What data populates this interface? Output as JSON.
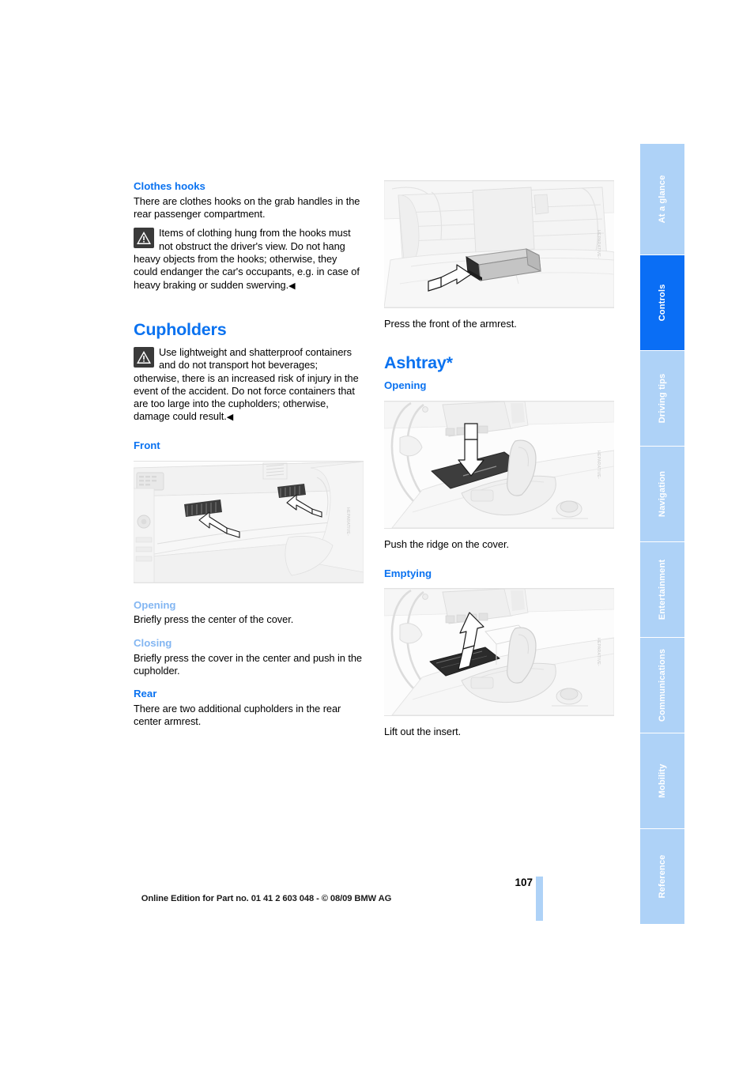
{
  "page": {
    "number": "107",
    "footer_note": "Online Edition for Part no. 01 41 2 603 048 - © 08/09 BMW AG"
  },
  "left_column": {
    "clothes_hooks": {
      "heading": "Clothes hooks",
      "intro": "There are clothes hooks on the grab handles in the rear passenger compartment.",
      "warning": "Items of clothing hung from the hooks must not obstruct the driver's view. Do not hang heavy objects from the hooks; otherwise, they could endanger the car's occupants, e.g. in case of heavy braking or sudden swerving.",
      "warning_end": "◀"
    },
    "cupholders": {
      "heading": "Cupholders",
      "warning": "Use lightweight and shatterproof containers and do not transport hot beverages; otherwise, there is an increased risk of injury in the event of the accident. Do not force containers that are too large into the cupholders; otherwise, damage could result.",
      "warning_end": "◀",
      "front": {
        "heading": "Front",
        "figure_watermark": "HEPARATIVE-",
        "opening": {
          "heading": "Opening",
          "text": "Briefly press the center of the cover."
        },
        "closing": {
          "heading": "Closing",
          "text": "Briefly press the cover in the center and push in the cupholder."
        }
      },
      "rear": {
        "heading": "Rear",
        "text": "There are two additional cupholders in the rear center armrest."
      }
    }
  },
  "right_column": {
    "armrest_figure": {
      "watermark": "HEPARATIVE-",
      "caption": "Press the front of the armrest."
    },
    "ashtray": {
      "heading": "Ashtray*",
      "opening": {
        "heading": "Opening",
        "figure_watermark": "HEPARATIVE-",
        "caption": "Push the ridge on the cover."
      },
      "emptying": {
        "heading": "Emptying",
        "figure_watermark": "HEPARATIVE-",
        "caption": "Lift out the insert."
      }
    }
  },
  "tabs": [
    {
      "label": "At a glance",
      "active": false
    },
    {
      "label": "Controls",
      "active": true
    },
    {
      "label": "Driving tips",
      "active": false
    },
    {
      "label": "Navigation",
      "active": false
    },
    {
      "label": "Entertainment",
      "active": false
    },
    {
      "label": "Communications",
      "active": false
    },
    {
      "label": "Mobility",
      "active": false
    },
    {
      "label": "Reference",
      "active": false
    }
  ],
  "colors": {
    "accent_blue": "#0a72f0",
    "muted_blue": "#83b6f2",
    "tab_inactive": "#aed2f7",
    "tab_active": "#0a6ef5"
  }
}
